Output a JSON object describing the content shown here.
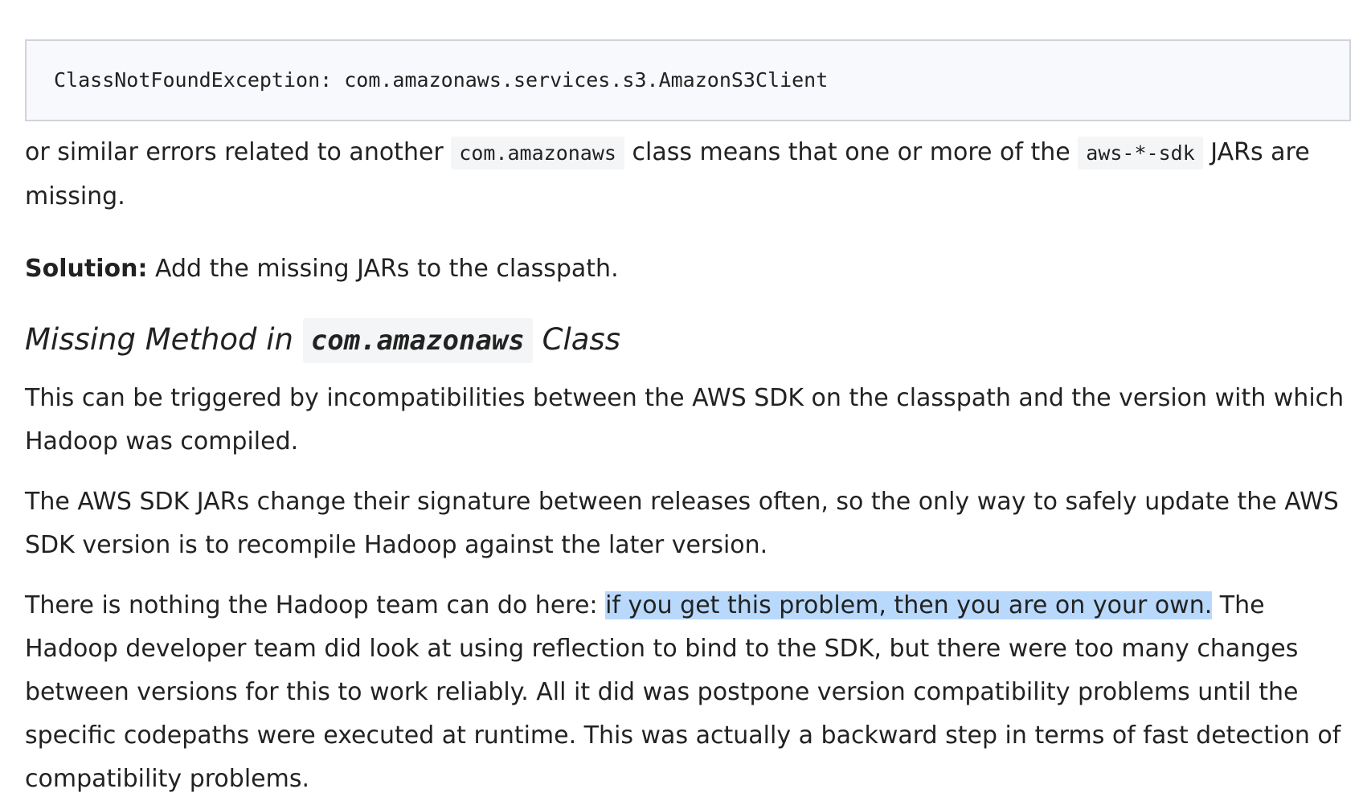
{
  "code_block": {
    "text": "ClassNotFoundException: com.amazonaws.services.s3.AmazonS3Client"
  },
  "para1": {
    "part1": "or similar errors related to another ",
    "code1": "com.amazonaws",
    "part2": " class means that one or more of the ",
    "code2": "aws-*-sdk",
    "part3": " JARs are missing."
  },
  "para2": {
    "bold": "Solution:",
    "rest": " Add the missing JARs to the classpath."
  },
  "heading": {
    "part1": "Missing Method in ",
    "code": "com.amazonaws",
    "part2": " Class"
  },
  "para3": {
    "text": "This can be triggered by incompatibilities between the AWS SDK on the classpath and the version with which Hadoop was compiled."
  },
  "para4": {
    "text": "The AWS SDK JARs change their signature between releases often, so the only way to safely update the AWS SDK version is to recompile Hadoop against the later version."
  },
  "para5": {
    "part1": "There is nothing the Hadoop team can do here: ",
    "highlight": "if you get this problem, then you are on your own.",
    "part2": " The Hadoop developer team did look at using reflection to bind to the SDK, but there were too many changes between versions for this to work reliably. All it did was postpone version compatibility problems until the specific codepaths were executed at runtime. This was actually a backward step in terms of fast detection of compatibility problems."
  },
  "colors": {
    "text": "#222222",
    "code_background": "#f8f9fc",
    "code_border": "#d0d3d8",
    "selection_highlight": "#b8d9fc"
  }
}
